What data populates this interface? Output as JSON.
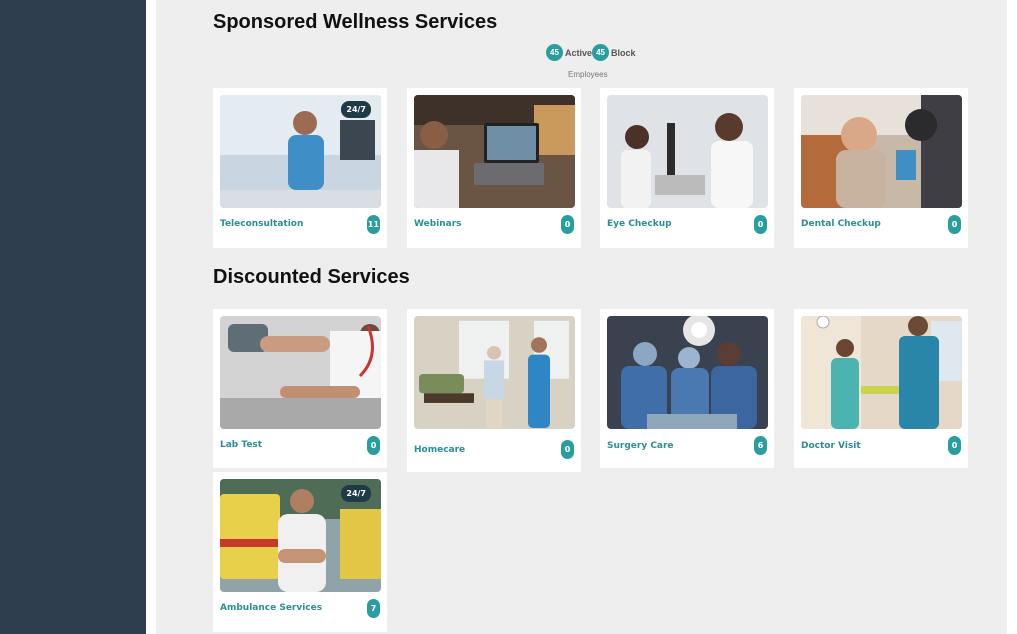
{
  "sections": {
    "sponsored": {
      "title": "Sponsored Wellness Services",
      "stats": {
        "active_count": "45",
        "active_label": "Active",
        "block_count": "45",
        "block_label": "Block",
        "employees_label": "Employees"
      },
      "cards": [
        {
          "label": "Teleconsultation",
          "count": "11",
          "badge": "24/7",
          "icon": "teleconsultation-photo"
        },
        {
          "label": "Webinars",
          "count": "0",
          "icon": "webinar-photo"
        },
        {
          "label": "Eye Checkup",
          "count": "0",
          "icon": "eye-checkup-photo"
        },
        {
          "label": "Dental Checkup",
          "count": "0",
          "icon": "dental-checkup-photo"
        }
      ]
    },
    "discounted": {
      "title": "Discounted Services",
      "cards": [
        {
          "label": "Lab Test",
          "count": "0",
          "icon": "lab-test-photo"
        },
        {
          "label": "Homecare",
          "count": "0",
          "icon": "homecare-photo"
        },
        {
          "label": "Surgery Care",
          "count": "6",
          "icon": "surgery-care-photo"
        },
        {
          "label": "Doctor Visit",
          "count": "0",
          "icon": "doctor-visit-photo"
        },
        {
          "label": "Ambulance Services",
          "count": "7",
          "badge": "24/7",
          "icon": "ambulance-photo"
        }
      ]
    }
  },
  "colors": {
    "sidebar": "#2e3e4f",
    "accent": "#2a9d9f",
    "content_bg": "#eeeeee"
  }
}
